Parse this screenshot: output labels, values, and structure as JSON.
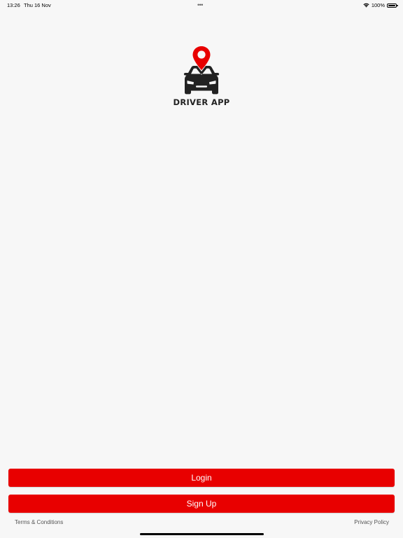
{
  "status_bar": {
    "time": "13:26",
    "date": "Thu 16 Nov",
    "multitask_dots": "•••",
    "battery_percent": "100%",
    "battery_level": 1.0,
    "wifi_icon": "wifi-icon",
    "battery_icon": "battery-icon"
  },
  "logo": {
    "text": "DRIVER APP",
    "icon": "car-with-location-pin-icon",
    "pin_color": "#e80000",
    "car_color": "#222222"
  },
  "actions": {
    "login_label": "Login",
    "signup_label": "Sign Up"
  },
  "footer": {
    "terms_label": "Terms & Conditions",
    "privacy_label": "Privacy Policy"
  },
  "colors": {
    "accent": "#e80000",
    "background": "#f7f7f7"
  }
}
